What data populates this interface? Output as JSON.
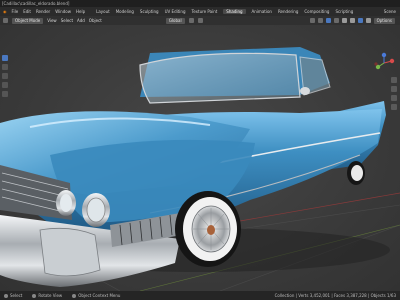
{
  "window": {
    "title": "[Cadillac\\cadillac_eldorado.blend]"
  },
  "menu": {
    "items": [
      "File",
      "Edit",
      "Render",
      "Window",
      "Help"
    ],
    "workspaces": [
      "Layout",
      "Modeling",
      "Sculpting",
      "UV Editing",
      "Texture Paint",
      "Shading",
      "Animation",
      "Rendering",
      "Compositing",
      "Scripting"
    ],
    "active_workspace": "Shading",
    "scene": "Scene"
  },
  "toolbar": {
    "mode": "Object Mode",
    "transform": "Global",
    "view": "View",
    "select": "Select",
    "add": "Add",
    "object": "Object",
    "options": "Options"
  },
  "status": {
    "left": "Select",
    "middle": "Rotate View",
    "right": "Object Context Menu",
    "stats": "Collection | Verts 3,452,001 | Faces 3,387,228 | Objects 1/63"
  },
  "colors": {
    "car_body": "#3e8fc2",
    "chrome": "#c8ccd0",
    "background": "#3a3a3a",
    "tire": "#1a1a1a",
    "whitewall": "#f2f2f2"
  }
}
